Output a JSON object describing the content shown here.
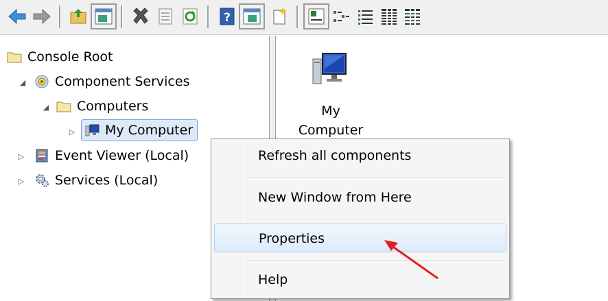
{
  "toolbar": {
    "buttons": [
      "back-icon",
      "forward-icon",
      "up-folder-icon",
      "show-hide-console-tree-icon",
      "delete-icon",
      "properties-icon",
      "refresh-icon",
      "help-icon",
      "show-hide-action-pane-icon",
      "new-window-icon",
      "large-icons-view-icon",
      "small-icons-view-icon",
      "list-view-icon",
      "detail-view-icon",
      "filter-view-icon"
    ]
  },
  "tree": {
    "console_root": "Console Root",
    "component_services": "Component Services",
    "computers": "Computers",
    "my_computer": "My Computer",
    "event_viewer": "Event Viewer (Local)",
    "services": "Services (Local)"
  },
  "content": {
    "item_label": "My Computer"
  },
  "context_menu": {
    "items": [
      "Refresh all components",
      "New Window from Here",
      "Properties",
      "Help"
    ],
    "hovered": "Properties"
  },
  "colors": {
    "selection_bg": "#dce9f9",
    "selection_border": "#7da2ce",
    "annotation_arrow": "#e02020"
  }
}
